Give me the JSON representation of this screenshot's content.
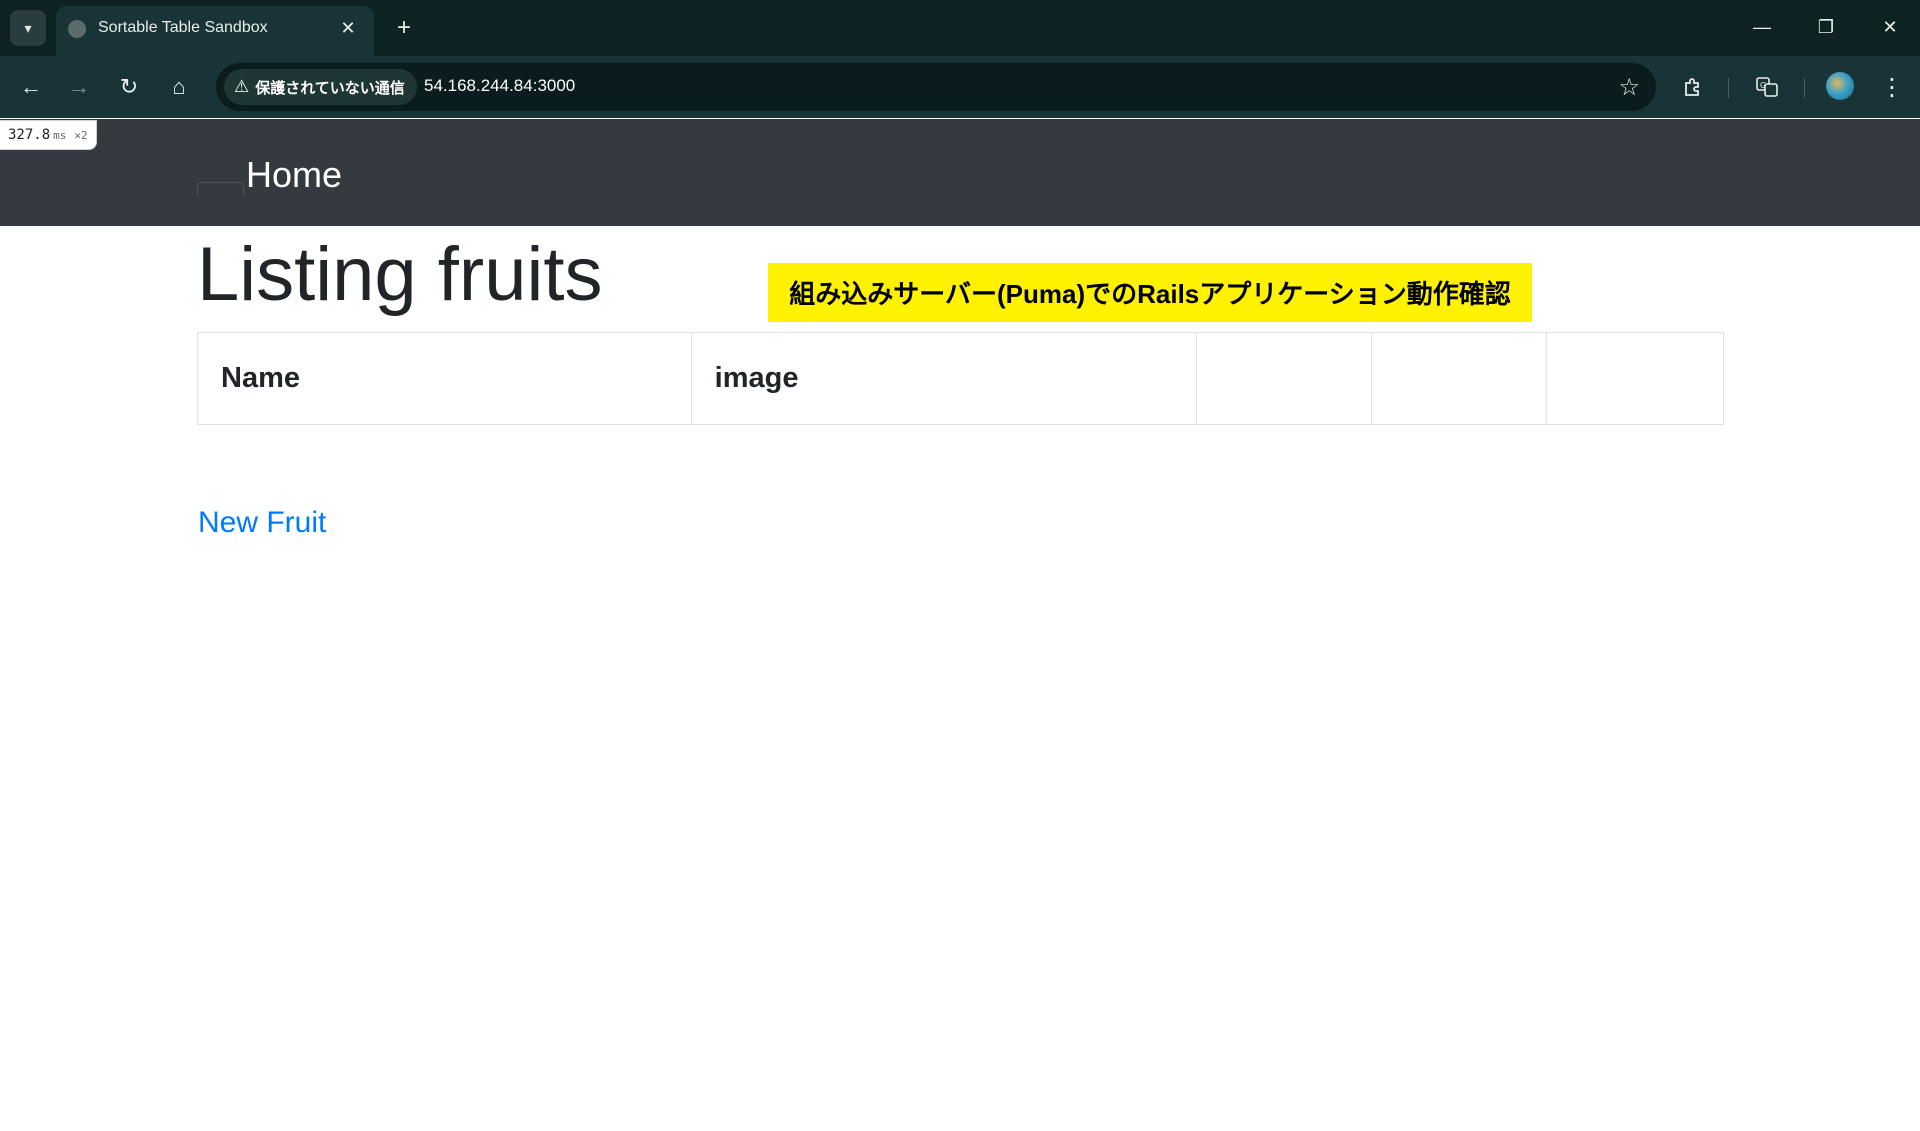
{
  "browser": {
    "tab_title": "Sortable Table Sandbox",
    "tab_search_icon": "chevron-down-icon",
    "close_glyph": "✕",
    "new_tab_glyph": "+",
    "security_label": "保護されていない通信",
    "url": "54.168.244.84:3000",
    "window_controls": {
      "minimize": "—",
      "restore": "❐",
      "close": "✕"
    },
    "nav": {
      "back": "←",
      "forward": "→",
      "reload": "↻",
      "home": "⌂"
    },
    "star_glyph": "☆",
    "menu_glyph": "⋮"
  },
  "perf_overlay": {
    "value": "327.8",
    "unit": "ms",
    "multiplier": "×2"
  },
  "navbar": {
    "brand": "Home"
  },
  "banner": {
    "text": "組み込みサーバー(Puma)でのRailsアプリケーション動作確認",
    "background": "#fff200"
  },
  "page": {
    "title": "Listing fruits",
    "table": {
      "headers": [
        "Name",
        "image",
        "",
        "",
        ""
      ]
    },
    "new_link": "New Fruit"
  },
  "colors": {
    "navbar": "#343a40",
    "link": "#007bff",
    "chrome": "#0c2223"
  }
}
